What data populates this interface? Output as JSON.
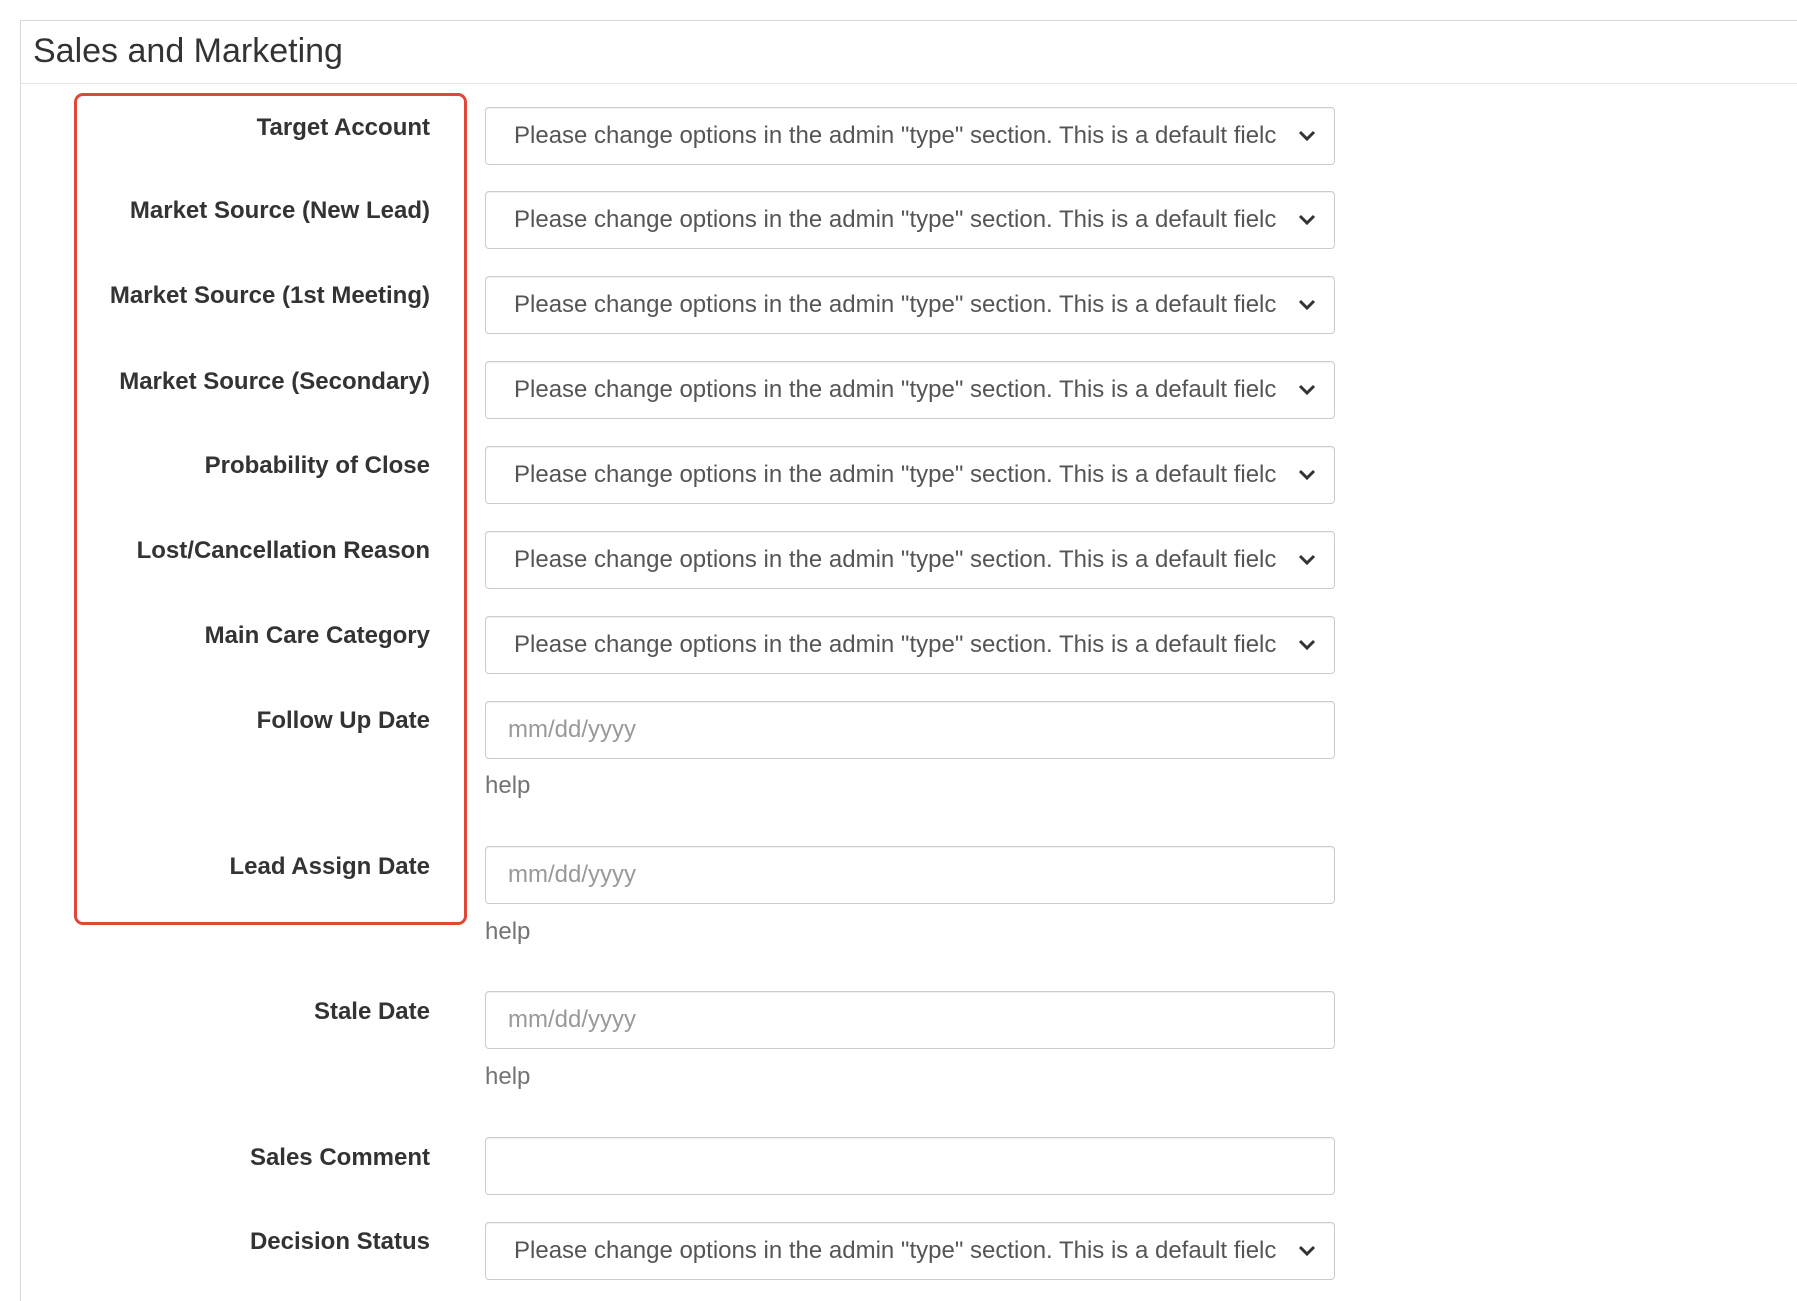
{
  "section": {
    "title": "Sales and Marketing"
  },
  "select_placeholder": "Please change options in the admin \"type\" section. This is a default fielc",
  "fields": {
    "target_account": {
      "label": "Target Account",
      "value": "Please change options in the admin \"type\" section. This is a default fielc"
    },
    "market_source_new_lead": {
      "label": "Market Source (New Lead)",
      "value": "Please change options in the admin \"type\" section. This is a default fielc"
    },
    "market_source_1st_meeting": {
      "label": "Market Source (1st Meeting)",
      "value": "Please change options in the admin \"type\" section. This is a default fielc"
    },
    "market_source_secondary": {
      "label": "Market Source (Secondary)",
      "value": "Please change options in the admin \"type\" section. This is a default fielc"
    },
    "probability_of_close": {
      "label": "Probability of Close",
      "value": "Please change options in the admin \"type\" section. This is a default fielc"
    },
    "lost_cancellation_reason": {
      "label": "Lost/Cancellation Reason",
      "value": "Please change options in the admin \"type\" section. This is a default fielc"
    },
    "main_care_category": {
      "label": "Main Care Category",
      "value": "Please change options in the admin \"type\" section. This is a default fielc"
    },
    "follow_up_date": {
      "label": "Follow Up Date",
      "placeholder": "mm/dd/yyyy",
      "help": "help"
    },
    "lead_assign_date": {
      "label": "Lead Assign Date",
      "placeholder": "mm/dd/yyyy",
      "help": "help"
    },
    "stale_date": {
      "label": "Stale Date",
      "placeholder": "mm/dd/yyyy",
      "help": "help"
    },
    "sales_comment": {
      "label": "Sales Comment",
      "value": ""
    },
    "decision_status": {
      "label": "Decision Status",
      "value": "Please change options in the admin \"type\" section. This is a default fielc"
    }
  },
  "colors": {
    "highlight": "#e0473a",
    "label": "#333333",
    "input_border": "#cccccc",
    "placeholder": "#999999",
    "help": "#737373"
  },
  "icons": {
    "dropdown": "chevron-down-icon"
  }
}
